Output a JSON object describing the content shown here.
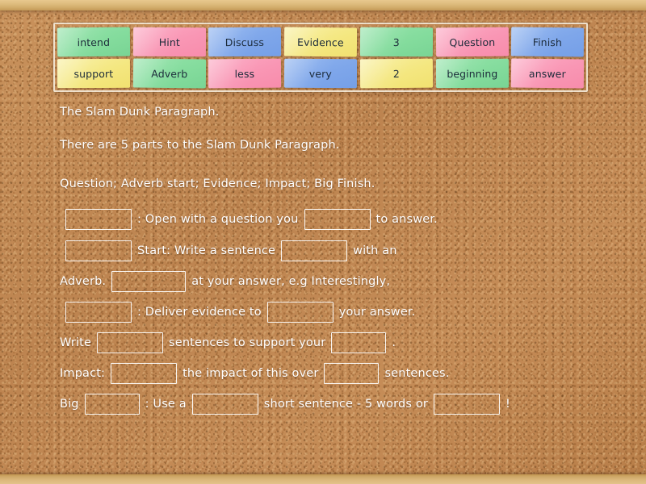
{
  "activity": {
    "title": "The Slam Dunk Paragraph.",
    "type": "fill-in-the-blanks-drag-drop"
  },
  "tile_bank": {
    "rows": [
      [
        {
          "label": "intend",
          "color": "#84dc9d",
          "color_name": "green"
        },
        {
          "label": "Hint",
          "color": "#f996b4",
          "color_name": "pink"
        },
        {
          "label": "Discuss",
          "color": "#7ea6ea",
          "color_name": "blue"
        },
        {
          "label": "Evidence",
          "color": "#f4e780",
          "color_name": "yellow"
        },
        {
          "label": "3",
          "color": "#84dc9d",
          "color_name": "green"
        },
        {
          "label": "Question",
          "color": "#f996b4",
          "color_name": "pink"
        },
        {
          "label": "Finish",
          "color": "#7ea6ea",
          "color_name": "blue"
        }
      ],
      [
        {
          "label": "support",
          "color": "#f4e780",
          "color_name": "yellow"
        },
        {
          "label": "Adverb",
          "color": "#84dc9d",
          "color_name": "green"
        },
        {
          "label": "less",
          "color": "#f996b4",
          "color_name": "pink"
        },
        {
          "label": "very",
          "color": "#7ea6ea",
          "color_name": "blue"
        },
        {
          "label": "2",
          "color": "#f4e780",
          "color_name": "yellow"
        },
        {
          "label": "beginning",
          "color": "#84dc9d",
          "color_name": "green"
        },
        {
          "label": "answer",
          "color": "#f996b4",
          "color_name": "pink"
        }
      ]
    ]
  },
  "body": {
    "line1": "The Slam Dunk Paragraph.",
    "line2": "There are 5 parts to the Slam Dunk Paragraph.",
    "line3": "Question; Adverb start; Evidence; Impact; Big Finish.",
    "line4_a": ": Open with a question you",
    "line4_b": "to answer.",
    "line5_a": "Start: Write a sentence",
    "line5_b": "with an",
    "line6_a": "Adverb.",
    "line6_b": "at your answer, e.g Interestingly,",
    "line7_a": ": Deliver evidence to",
    "line7_b": "your answer.",
    "line8_a": "Write",
    "line8_b": "sentences to support your",
    "line8_c": ".",
    "line9_a": "Impact:",
    "line9_b": "the impact of this over",
    "line9_c": "sentences.",
    "line10_a": "Big",
    "line10_b": ": Use a",
    "line10_c": "short sentence - 5 words or",
    "line10_d": "!"
  },
  "theme": {
    "board_color": "#c08a52",
    "frame_color": "#dfbd7f",
    "text_color": "#ffffff",
    "blank_border_color": "#ffffff"
  }
}
